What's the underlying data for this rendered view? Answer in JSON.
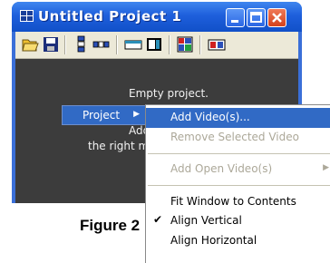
{
  "window": {
    "title": "Untitled Project 1",
    "controls": [
      "minimize",
      "maximize",
      "close"
    ]
  },
  "toolbar": {
    "icons": [
      "open-folder-icon",
      "save-icon",
      "vertical-layout-icon",
      "horizontal-layout-icon",
      "window-icon",
      "fit-icon",
      "grid-icon",
      "frames-icon"
    ]
  },
  "content": {
    "line1": "Empty project.",
    "line2_visible": "Add video",
    "line3_visible": "the right m"
  },
  "context_menu": {
    "parent_item": "Project",
    "items": [
      {
        "label": "Add Video(s)...",
        "state": "highlighted"
      },
      {
        "label": "Remove Selected Video",
        "state": "disabled"
      },
      {
        "label": "Add Open Video(s)",
        "state": "disabled",
        "submenu": true
      },
      {
        "label": "Fit Window to Contents",
        "state": "normal"
      },
      {
        "label": "Align Vertical",
        "state": "checked"
      },
      {
        "label": "Align Horizontal",
        "state": "normal"
      }
    ]
  },
  "caption": "Figure 2",
  "colors": {
    "titlebar": "#1e5fdc",
    "highlight": "#316ac5",
    "content_bg": "#3c3c3c",
    "toolbar_bg": "#ece9d8"
  }
}
